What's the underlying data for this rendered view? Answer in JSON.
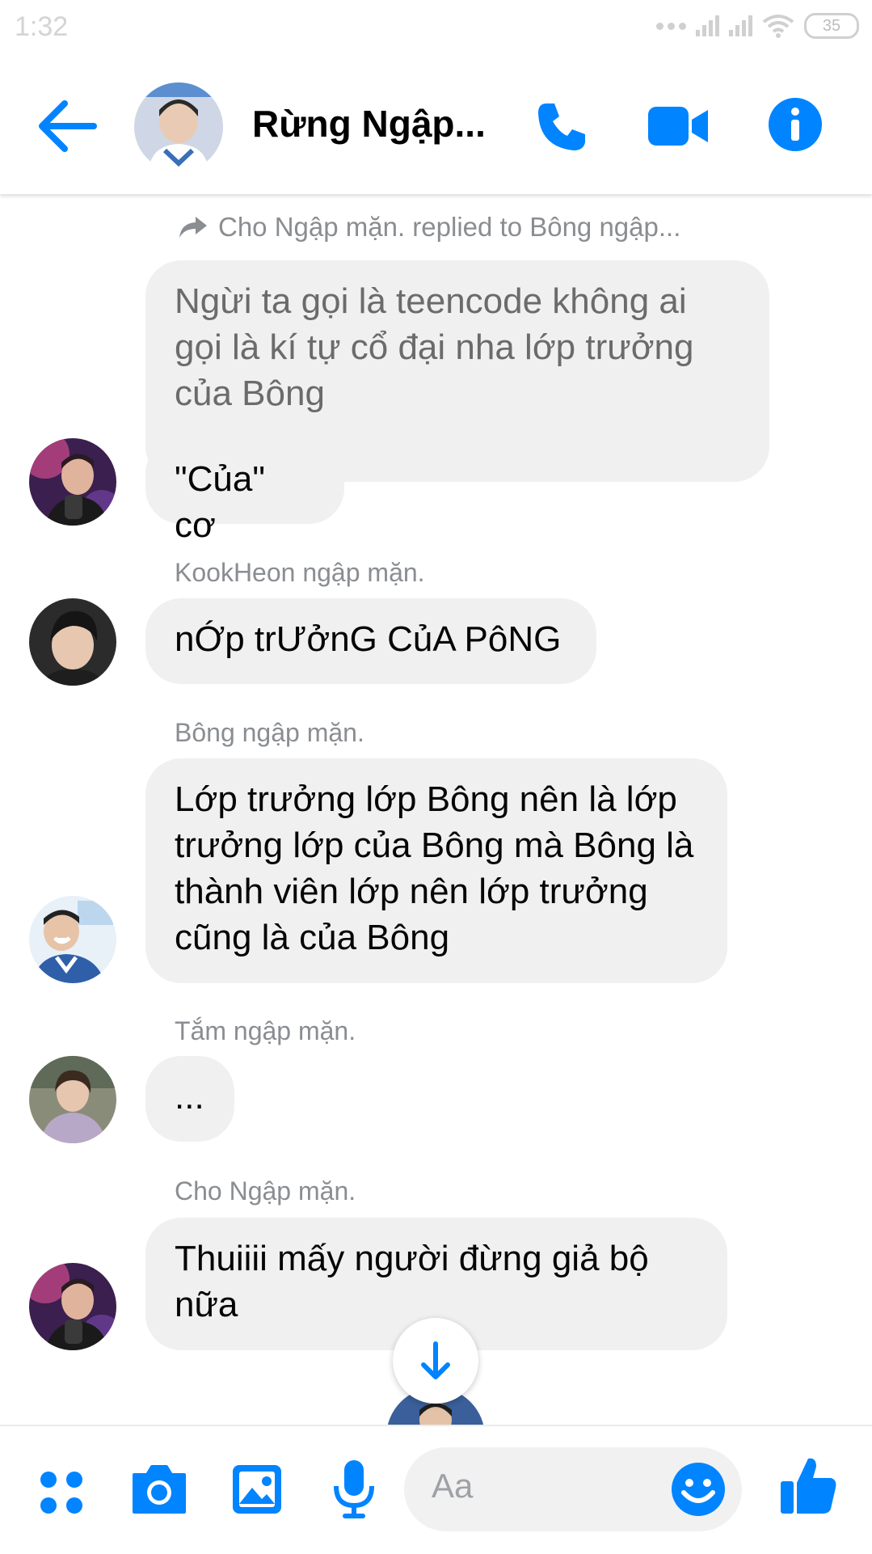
{
  "status_bar": {
    "time": "1:32",
    "battery": "35"
  },
  "header": {
    "title": "Rừng Ngập..."
  },
  "messages": {
    "reply_reference": "Cho Ngập mặn. replied to Bông ngập...",
    "quoted_text": "Ngừi ta gọi là teencode không ai gọi là kí tự cổ đại nha lớp trưởng của Bông",
    "m1": "\"Của\" cơ",
    "sender2": "KookHeon ngập mặn.",
    "m2": "nỚp trƯởnG CủA PôNG",
    "sender3": "Bông ngập mặn.",
    "m3": "Lớp trưởng lớp Bông nên là lớp trưởng lớp của Bông mà Bông là thành viên lớp nên lớp trưởng cũng là của Bông",
    "sender4": "Tắm ngập mặn.",
    "m4": "...",
    "sender5": "Cho Ngập mặn.",
    "m5": "Thuiiii mấy người đừng giả bộ nữa"
  },
  "composer": {
    "placeholder": "Aa"
  },
  "colors": {
    "accent": "#0084ff",
    "bubble": "#f1f0f0",
    "meta_text": "#8a8d91"
  },
  "icons": [
    "back-arrow-icon",
    "phone-icon",
    "video-camera-icon",
    "info-icon",
    "apps-grid-icon",
    "camera-icon",
    "image-icon",
    "microphone-icon",
    "emoji-icon",
    "thumbs-up-icon",
    "arrow-down-icon",
    "reply-arrow-icon"
  ]
}
